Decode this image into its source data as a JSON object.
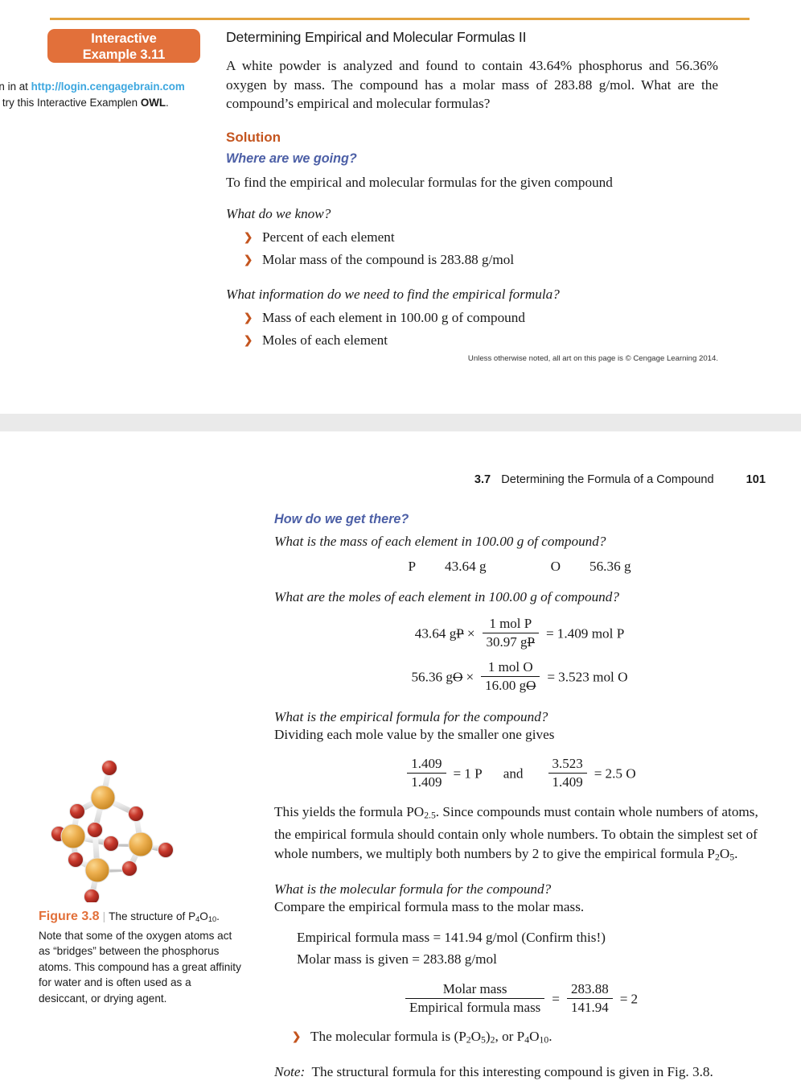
{
  "page_one": {
    "badge": {
      "line1": "Interactive",
      "line2": "Example 3.11"
    },
    "sidebar_note": {
      "prefix": "ign in at ",
      "link_line1": "http://login.cengagebrain",
      "link_line2": ".com",
      "rest": " to try this Interactive Example",
      "last_prefix": "n ",
      "last_bold": "OWL",
      "last_suffix": "."
    },
    "title": "Determining Empirical and Molecular Formulas II",
    "problem": "A white powder is analyzed and found to contain 43.64% phosphorus and 56.36% oxygen by mass. The compound has a molar mass of 283.88 g/mol. What are the compound’s empirical and molecular formulas?",
    "solution_heading": "Solution",
    "where_heading": "Where are we going?",
    "where_body": "To find the empirical and molecular formulas for the given compound",
    "know_heading": "What do we know?",
    "know_items": [
      "Percent of each element",
      "Molar mass of the compound is 283.88 g/mol"
    ],
    "need_heading": "What information do we need to find the empirical formula?",
    "need_items": [
      "Mass of each element in 100.00 g of compound",
      "Moles of each element"
    ],
    "copyright": "Unless otherwise noted, all art on this page is © Cengage Learning 2014."
  },
  "page_two": {
    "running_head": {
      "section_number": "3.7",
      "section_title": "Determining the Formula of a Compound",
      "page_number": "101"
    },
    "how_heading": "How do we get there?",
    "mass_question": "What is the mass of each element in 100.00 g of compound?",
    "mass_row": {
      "element_1": "P",
      "value_1": "43.64 g",
      "element_2": "O",
      "value_2": "56.36 g"
    },
    "moles_question": "What are the moles of each element in 100.00 g of compound?",
    "mole_calc_p": {
      "mass": "43.64 g",
      "cancel_unit": "P",
      "times": "×",
      "numerator": "1 mol P",
      "denominator_value": "30.97 g",
      "denominator_cancel": "P",
      "equals": "=",
      "result": "1.409 mol P"
    },
    "mole_calc_o": {
      "mass": "56.36 g",
      "cancel_unit": "O",
      "times": "×",
      "numerator": "1 mol O",
      "denominator_value": "16.00 g",
      "denominator_cancel": "O",
      "equals": "=",
      "result": "3.523 mol O"
    },
    "empirical_question": "What is the empirical formula for the compound?",
    "dividing_line": "Dividing each mole value by the smaller one gives",
    "ratio_p": {
      "numerator": "1.409",
      "denominator": "1.409",
      "equals": "=",
      "result": "1 P"
    },
    "ratio_conjunction": "and",
    "ratio_o": {
      "numerator": "3.523",
      "denominator": "1.409",
      "equals": "=",
      "result": "2.5 O"
    },
    "yields_para_1": "This yields the formula PO",
    "yields_sub_1": "2.5",
    "yields_para_2": ". Since compounds must contain whole numbers of atoms, the empirical formula should contain only whole numbers. To obtain the simplest set of whole numbers, we multiply both numbers by 2 to give the empirical formula P",
    "yields_sub_2": "2",
    "yields_para_3": "O",
    "yields_sub_3": "5",
    "yields_para_4": ".",
    "molecular_question": "What is the molecular formula for the compound?",
    "compare_line": "Compare the empirical formula mass to the molar mass.",
    "empirical_mass_line": "Empirical formula mass = 141.94 g/mol (Confirm this!)",
    "molar_mass_line": "Molar mass is given = 283.88 g/mol",
    "mass_ratio": {
      "numerator": "Molar mass",
      "denominator": "Empirical formula mass",
      "equals_1": "=",
      "num_value": "283.88",
      "den_value": "141.94",
      "equals_2": "=",
      "result": "2"
    },
    "molecular_result": {
      "prefix": "The molecular formula is (P",
      "s1": "2",
      "mid1": "O",
      "s2": "5",
      "mid2": ")",
      "s3": "2",
      "mid3": ", or P",
      "s4": "4",
      "mid4": "O",
      "s5": "10",
      "suffix": "."
    },
    "note": {
      "label": "Note:",
      "text": "The structural formula for this interesting compound is given in Fig. 3.8."
    },
    "figure": {
      "label": "Figure 3.8",
      "divider": "|",
      "caption_part1": "The structure of P",
      "caption_sub1": "4",
      "caption_part2": "O",
      "caption_sub2": "10",
      "caption_rest": ". Note that some of the oxygen atoms act as “bridges” between the phosphorus atoms. This compound has a great affinity for water and is often used as a desiccant, or drying agent.",
      "molecule_name": "P4O10 ball-and-stick model",
      "phosphorus_color": "#E8AE4A",
      "oxygen_color": "#C03428",
      "bond_color": "#DEDEDE"
    }
  },
  "bullet_glyph": "❯",
  "colors": {
    "accent_orange": "#E2703A",
    "rule_gold": "#E3A33E",
    "heading_rust": "#C4551F",
    "heading_blue": "#4C5FA6",
    "link_blue": "#3DA7DF",
    "page_gap": "#EAEAEA"
  }
}
